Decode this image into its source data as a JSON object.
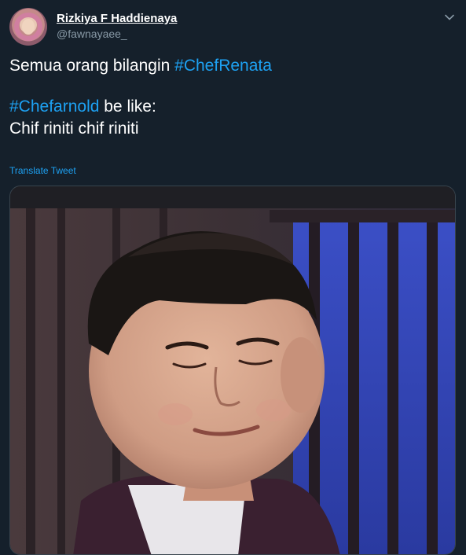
{
  "tweet": {
    "author_name": "Rizkiya F Haddienaya",
    "author_handle": "@fawnayaee_",
    "lines": [
      {
        "text": "Semua orang bilangin ",
        "hashtag": "#ChefRenata"
      },
      {
        "text": "",
        "hashtag": ""
      },
      {
        "text": " be like:",
        "hashtag": "#Chefarnold"
      },
      {
        "text": "Chif riniti chif riniti",
        "hashtag": ""
      }
    ],
    "translate_label": "Translate Tweet"
  },
  "colors": {
    "background": "#15202b",
    "link": "#1da1f2",
    "secondary_text": "#8899a6",
    "border": "#38444d"
  },
  "icons": {
    "more": "chevron-down-icon"
  }
}
